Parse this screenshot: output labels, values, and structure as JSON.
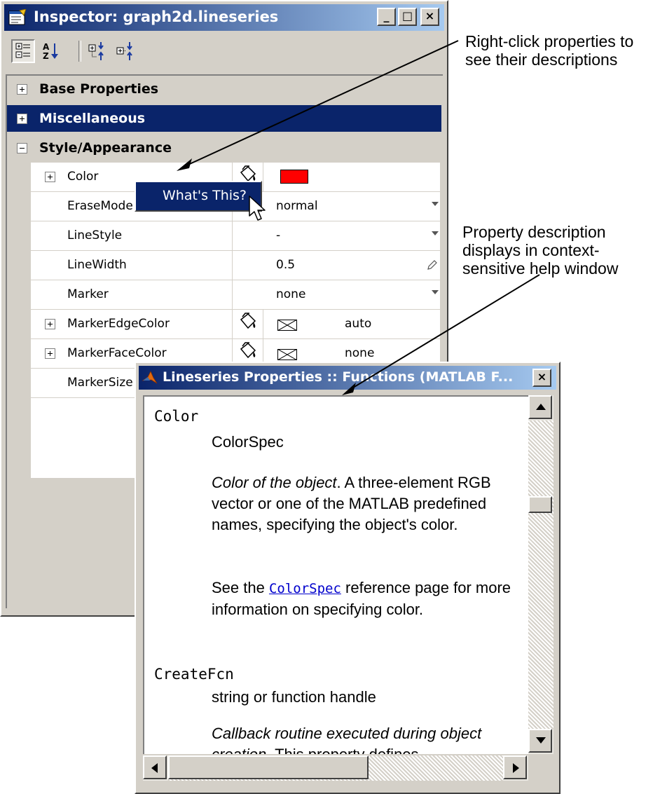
{
  "inspector": {
    "title": "Inspector: graph2d.lineseries",
    "window_buttons": [
      "_",
      "□",
      "×"
    ],
    "toolbar": [
      {
        "name": "categorized-view-icon",
        "pressed": true
      },
      {
        "name": "sort-alphabetical-icon",
        "pressed": false
      },
      {
        "name": "expand-all-icon",
        "pressed": false
      },
      {
        "name": "collapse-all-icon",
        "pressed": false
      }
    ],
    "categories": [
      {
        "label": "Base Properties",
        "expanded": false,
        "selected": false
      },
      {
        "label": "Miscellaneous",
        "expanded": false,
        "selected": true
      },
      {
        "label": "Style/Appearance",
        "expanded": true,
        "selected": false
      }
    ],
    "properties": [
      {
        "name": "Color",
        "expandable": true,
        "value": "",
        "control": "color-swatch"
      },
      {
        "name": "EraseMode",
        "expandable": false,
        "value": "normal",
        "control": "dropdown"
      },
      {
        "name": "LineStyle",
        "expandable": false,
        "value": "-",
        "control": "dropdown"
      },
      {
        "name": "LineWidth",
        "expandable": false,
        "value": "0.5",
        "control": "edit"
      },
      {
        "name": "Marker",
        "expandable": false,
        "value": "none",
        "control": "dropdown"
      },
      {
        "name": "MarkerEdgeColor",
        "expandable": true,
        "value": "auto",
        "control": "color-none"
      },
      {
        "name": "MarkerFaceColor",
        "expandable": true,
        "value": "none",
        "control": "color-none"
      },
      {
        "name": "MarkerSize",
        "expandable": false,
        "value": "",
        "control": "edit"
      }
    ],
    "color_value": "#ff0000",
    "context_menu": {
      "item": "What's This?"
    }
  },
  "help": {
    "title": "Lineseries Properties :: Functions (MATLAB F...",
    "close": "×",
    "entries": [
      {
        "name": "Color",
        "type": "ColorSpec",
        "desc_italic": "Color of the object",
        "desc_rest": ". A three-element RGB vector or one of the MATLAB predefined names, specifying the object's color.",
        "see_prefix": "See the ",
        "see_link": "ColorSpec",
        "see_suffix": " reference page for more information on specifying color."
      },
      {
        "name": "CreateFcn",
        "type": "string or function handle",
        "desc_italic": "Callback routine executed during object creation",
        "desc_rest": ". This property defines"
      }
    ]
  },
  "callouts": {
    "right_click": "Right-click properties to see their descriptions",
    "right_click_line1": "Right-click properties to",
    "right_click_line2": "see their descriptions",
    "description_line1": "Property description",
    "description_line2": "displays in context-",
    "description_line3": "sensitive help window"
  },
  "colors": {
    "title_bar": "#0a246a",
    "window_face": "#d4d0c8",
    "link": "#0000cc"
  }
}
